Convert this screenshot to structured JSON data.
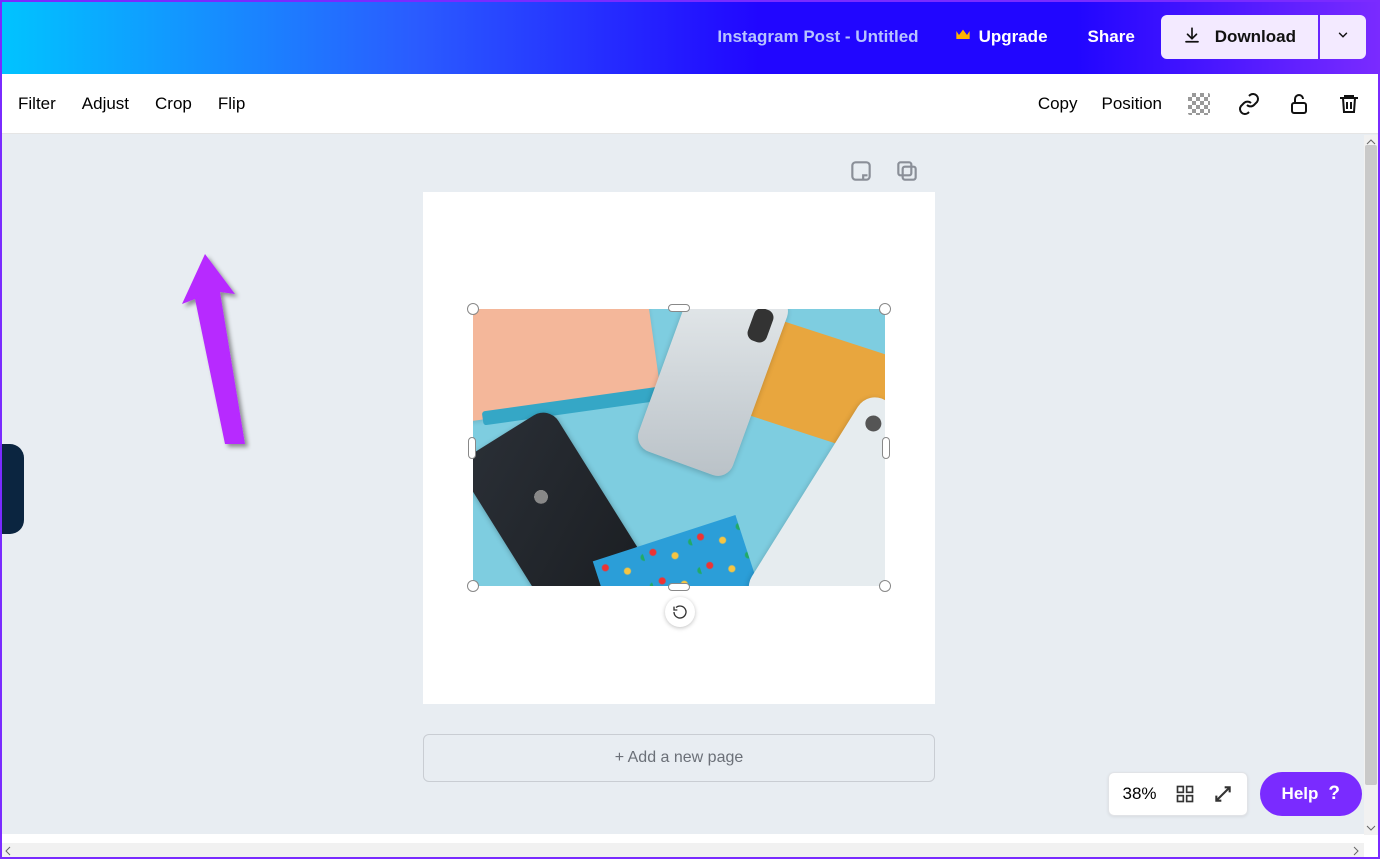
{
  "header": {
    "doc_title": "Instagram Post - Untitled",
    "upgrade_label": "Upgrade",
    "share_label": "Share",
    "download_label": "Download"
  },
  "toolbar": {
    "filter": "Filter",
    "adjust": "Adjust",
    "crop": "Crop",
    "flip": "Flip",
    "copy": "Copy",
    "position": "Position"
  },
  "canvas": {
    "add_page_label": "+ Add a new page"
  },
  "footer": {
    "zoom": "38%",
    "help_label": "Help"
  }
}
